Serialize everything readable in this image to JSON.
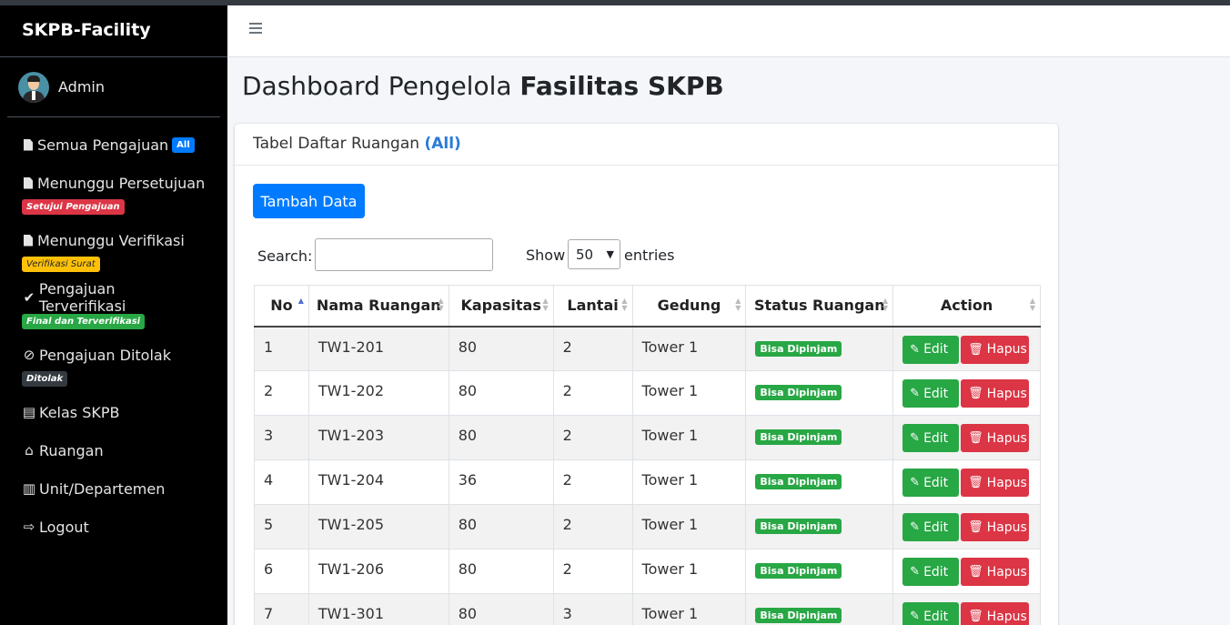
{
  "app": {
    "brand": "SKPB-Facility",
    "user": "Admin"
  },
  "sidebar": {
    "items": [
      {
        "label": "Semua Pengajuan",
        "badge": "All",
        "icon": "file-icon"
      },
      {
        "label": "Menunggu Persetujuan",
        "badge": "Setujui Pengajuan",
        "icon": "file-icon"
      },
      {
        "label": "Menunggu Verifikasi",
        "badge": "Verifikasi Surat",
        "icon": "file-icon"
      },
      {
        "label": "Pengajuan Terverifikasi",
        "badge": "Final dan Terverifikasi",
        "icon": "check-icon"
      },
      {
        "label": "Pengajuan Ditolak",
        "badge": "Ditolak",
        "icon": "ban-icon"
      },
      {
        "label": "Kelas SKPB",
        "icon": "book-icon"
      },
      {
        "label": "Ruangan",
        "icon": "home-icon"
      },
      {
        "label": "Unit/Departemen",
        "icon": "building-icon"
      },
      {
        "label": "Logout",
        "icon": "sign-out-icon"
      }
    ]
  },
  "page": {
    "title_plain": "Dashboard Pengelola ",
    "title_bold": "Fasilitas SKPB"
  },
  "card": {
    "header_plain": "Tabel Daftar Ruangan ",
    "header_highlight": "(All)",
    "add_button": "Tambah Data",
    "search_label": "Search:",
    "search_value": "",
    "show_label": "Show",
    "page_size": "50",
    "entries_label": "entries"
  },
  "table": {
    "columns": [
      "No",
      "Nama Ruangan",
      "Kapasitas",
      "Lantai",
      "Gedung",
      "Status Ruangan",
      "Action"
    ],
    "rows": [
      {
        "no": "1",
        "nama": "TW1-201",
        "kapasitas": "80",
        "lantai": "2",
        "gedung": "Tower 1",
        "status": "Bisa Dipinjam"
      },
      {
        "no": "2",
        "nama": "TW1-202",
        "kapasitas": "80",
        "lantai": "2",
        "gedung": "Tower 1",
        "status": "Bisa Dipinjam"
      },
      {
        "no": "3",
        "nama": "TW1-203",
        "kapasitas": "80",
        "lantai": "2",
        "gedung": "Tower 1",
        "status": "Bisa Dipinjam"
      },
      {
        "no": "4",
        "nama": "TW1-204",
        "kapasitas": "36",
        "lantai": "2",
        "gedung": "Tower 1",
        "status": "Bisa Dipinjam"
      },
      {
        "no": "5",
        "nama": "TW1-205",
        "kapasitas": "80",
        "lantai": "2",
        "gedung": "Tower 1",
        "status": "Bisa Dipinjam"
      },
      {
        "no": "6",
        "nama": "TW1-206",
        "kapasitas": "80",
        "lantai": "2",
        "gedung": "Tower 1",
        "status": "Bisa Dipinjam"
      },
      {
        "no": "7",
        "nama": "TW1-301",
        "kapasitas": "80",
        "lantai": "3",
        "gedung": "Tower 1",
        "status": "Bisa Dipinjam"
      }
    ],
    "edit_label": "Edit",
    "delete_label": "Hapus"
  }
}
